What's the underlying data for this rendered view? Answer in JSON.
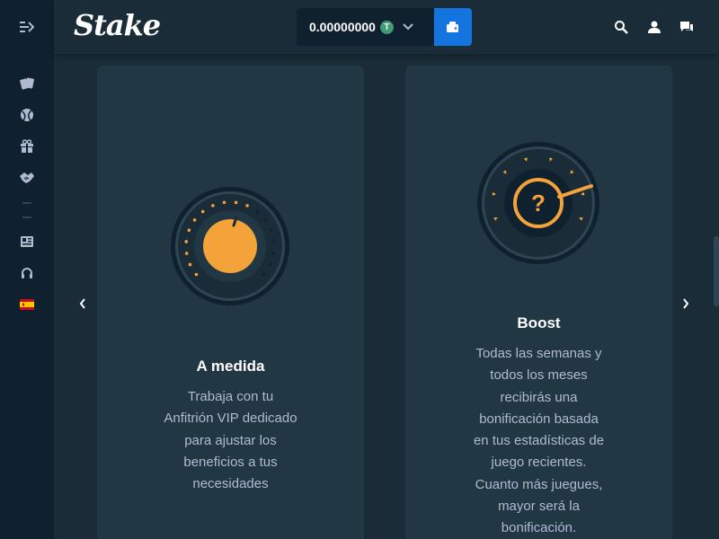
{
  "header": {
    "logo_text": "Stake",
    "balance": "0.00000000",
    "currency_symbol": "T"
  },
  "colors": {
    "accent_orange": "#f3a33a",
    "wallet_blue": "#1475e1",
    "tether_green": "#3f9b75"
  },
  "sidebar": {
    "items": [
      {
        "icon": "casino-cards-icon"
      },
      {
        "icon": "sports-ball-icon"
      },
      {
        "icon": "gift-icon"
      },
      {
        "icon": "handshake-icon"
      },
      {
        "icon": "news-icon"
      },
      {
        "icon": "headset-support-icon"
      },
      {
        "icon": "spain-flag-icon"
      }
    ]
  },
  "cards": [
    {
      "title": "A medida",
      "text": "Trabaja con tu\nAnfitrión VIP dedicado\npara ajustar los\nbeneficios a tus\nnecesidades"
    },
    {
      "title": "Boost",
      "text": "Todas las semanas y\ntodos los meses\nrecibirás una\nbonificación basada\nen tus estadísticas de\njuego recientes.\nCuanto más juegues,\nmayor será la\nbonificación."
    }
  ]
}
